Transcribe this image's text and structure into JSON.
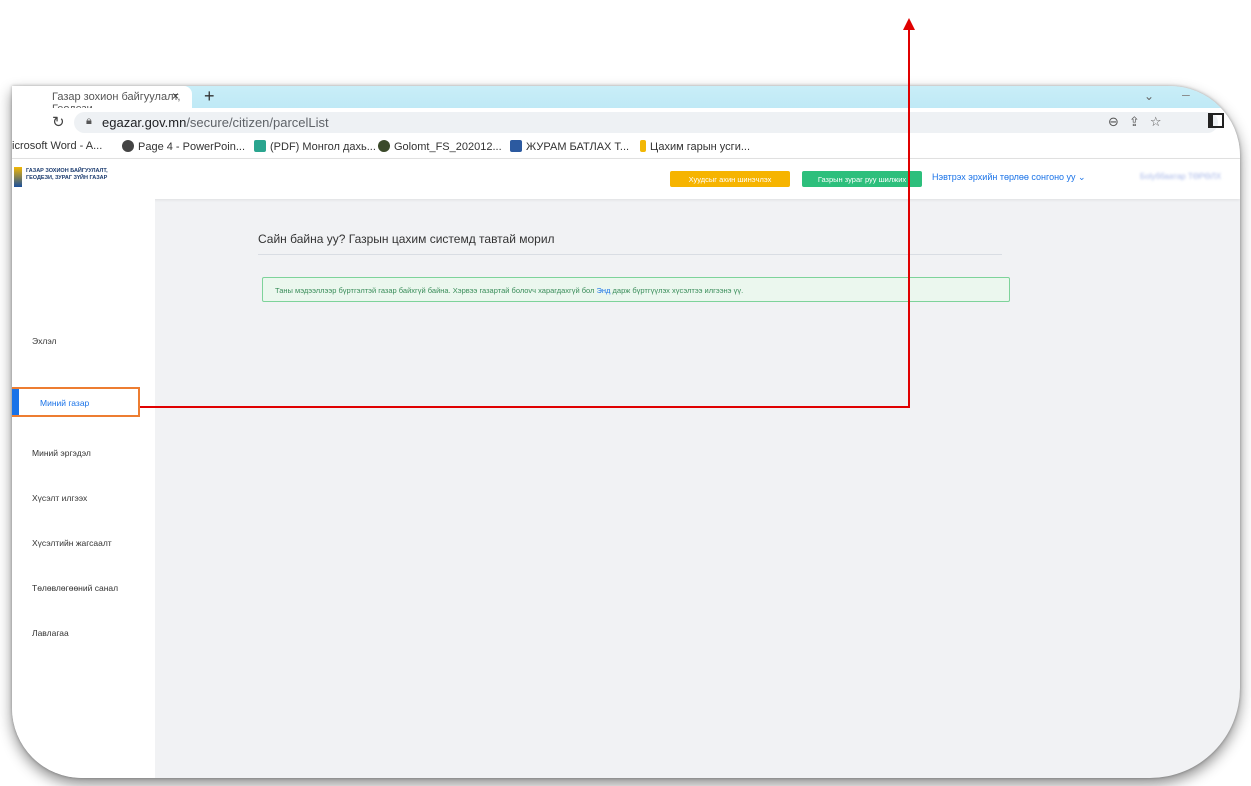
{
  "browser": {
    "tab_title": "Газар зохион байгуулалт, Геодези",
    "tab_close": "×",
    "new_tab": "+",
    "url_domain": "egazar.gov.mn",
    "url_path": "/secure/citizen/parcelList",
    "bookmarks": [
      "icrosoft Word - A...",
      "Page 4 - PowerPoin...",
      "(PDF) Монгол дахь...",
      "Golomt_FS_202012...",
      "ЖУРАМ БАТЛАХ Т...",
      "Цахим гарын усги..."
    ]
  },
  "header": {
    "logo_line1": "ГАЗАР ЗОХИОН БАЙГУУЛАЛТ,",
    "logo_line2": "ГЕОДЕЗИ, ЗУРАГ ЗҮЙН ГАЗАР",
    "btn_renew": "Хуудсыг ахин шинэчлэх",
    "btn_map": "Газрын зураг руу шилжих",
    "role_select": "Нэвтрэх эрхийн төрлөө сонгоно уу ⌄",
    "user_name": "Бolуббаатар ТӨРӨЛХ"
  },
  "sidebar": {
    "items": [
      "Эхлэл",
      "Миний газар",
      "Миний эргэдэл",
      "Хүсэлт илгээх",
      "Хүсэлтийн жагсаалт",
      "Төлөвлөгөөний санал",
      "Лавлагаа"
    ]
  },
  "main": {
    "greeting": "Сайн байна уу? Газрын цахим системд тавтай морил",
    "notice_before": "Таны мэдээллээр бүртгэлтэй газар байхгүй байна. Хэрвээ газартай болovч харагдахгүй бол ",
    "notice_link": "Энд",
    "notice_after": " дарж бүртгүүлэх хүсэлтээ илгээнэ үү."
  },
  "colors": {
    "accent_blue": "#1a73e8",
    "btn_yellow": "#f6b400",
    "btn_green": "#2dbf7c",
    "highlight_orange": "#ed7d31",
    "callout_red": "#e00000"
  }
}
